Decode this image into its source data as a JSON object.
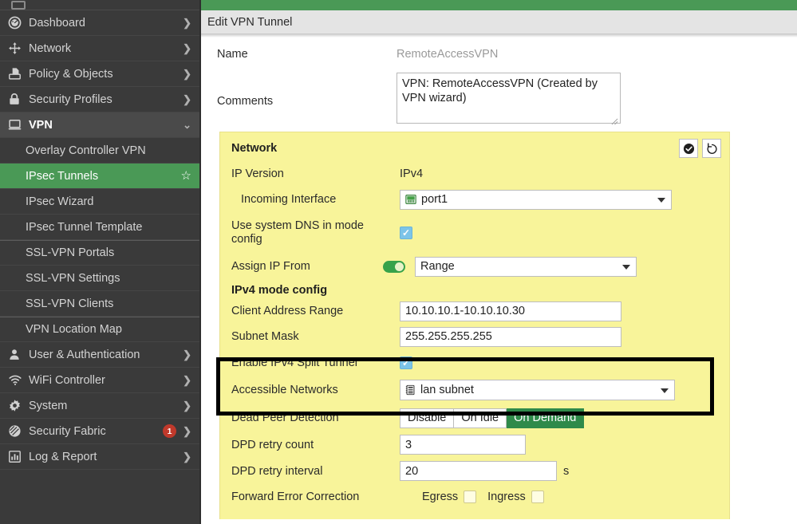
{
  "sidebar": {
    "items": [
      {
        "label": "Dashboard",
        "icon": "gauge-icon",
        "chevron": "❯",
        "type": "top"
      },
      {
        "label": "Network",
        "icon": "move-arrows-icon",
        "chevron": "❯",
        "type": "top"
      },
      {
        "label": "Policy & Objects",
        "icon": "policy-document-icon",
        "chevron": "❯",
        "type": "top"
      },
      {
        "label": "Security Profiles",
        "icon": "lock-icon",
        "chevron": "❯",
        "type": "top"
      },
      {
        "label": "VPN",
        "icon": "monitor-icon",
        "chevron": "⌄",
        "type": "top-expanded"
      },
      {
        "label": "Overlay Controller VPN",
        "type": "sub"
      },
      {
        "label": "IPsec Tunnels",
        "type": "sub-active",
        "star": "☆"
      },
      {
        "label": "IPsec Wizard",
        "type": "sub"
      },
      {
        "label": "IPsec Tunnel Template",
        "type": "sub"
      },
      {
        "label": "SSL-VPN Portals",
        "type": "sub"
      },
      {
        "label": "SSL-VPN Settings",
        "type": "sub"
      },
      {
        "label": "SSL-VPN Clients",
        "type": "sub"
      },
      {
        "label": "VPN Location Map",
        "type": "sub"
      },
      {
        "label": "User & Authentication",
        "icon": "user-icon",
        "chevron": "❯",
        "type": "top"
      },
      {
        "label": "WiFi Controller",
        "icon": "wifi-icon",
        "chevron": "❯",
        "type": "top"
      },
      {
        "label": "System",
        "icon": "gear-icon",
        "chevron": "❯",
        "type": "top"
      },
      {
        "label": "Security Fabric",
        "icon": "fabric-icon",
        "chevron": "❯",
        "type": "top",
        "badge": "1"
      },
      {
        "label": "Log & Report",
        "icon": "chart-bars-icon",
        "chevron": "❯",
        "type": "top"
      }
    ]
  },
  "dialog": {
    "title": "Edit VPN Tunnel",
    "name_label": "Name",
    "name_value": "RemoteAccessVPN",
    "comments_label": "Comments",
    "comments_value": "VPN: RemoteAccessVPN (Created by VPN wizard)"
  },
  "panel": {
    "title": "Network",
    "apply_icon": "check-circle-icon",
    "revert_icon": "undo-arrow-icon",
    "ip_version_label": "IP Version",
    "ip_version_value": "IPv4",
    "incoming_interface_label": "Incoming Interface",
    "incoming_interface_value": "port1",
    "incoming_interface_icon": "network-port-icon",
    "dns_label": "Use system DNS in mode config",
    "dns_checked": true,
    "assign_ip_label": "Assign IP From",
    "assign_ip_toggle_on": true,
    "assign_ip_value": "Range",
    "mode_config_label": "IPv4 mode config",
    "client_range_label": "Client Address Range",
    "client_range_value": "10.10.10.1-10.10.10.30",
    "subnet_mask_label": "Subnet Mask",
    "subnet_mask_value": "255.255.255.255",
    "split_tunnel_label": "Enable IPv4 Split Tunnel",
    "split_tunnel_checked": true,
    "accessible_networks_label": "Accessible Networks",
    "accessible_networks_value": "lan subnet",
    "accessible_networks_icon": "address-object-icon",
    "dpd_label": "Dead Peer Detection",
    "dpd_options": [
      "Disable",
      "On Idle",
      "On Demand"
    ],
    "dpd_selected": "On Demand",
    "dpd_retry_count_label": "DPD retry count",
    "dpd_retry_count_value": "3",
    "dpd_retry_interval_label": "DPD retry interval",
    "dpd_retry_interval_value": "20",
    "dpd_retry_interval_unit": "s",
    "fec_label": "Forward Error Correction",
    "fec_egress_label": "Egress",
    "fec_egress_checked": false,
    "fec_ingress_label": "Ingress",
    "fec_ingress_checked": false
  },
  "colors": {
    "accent_green": "#4a9956",
    "panel_yellow": "#f8f49a",
    "sidebar_dark": "#3a3a3a",
    "badge_red": "#c0392b",
    "checkbox_blue": "#7cc4e8",
    "selected_green": "#2f8a4a"
  }
}
